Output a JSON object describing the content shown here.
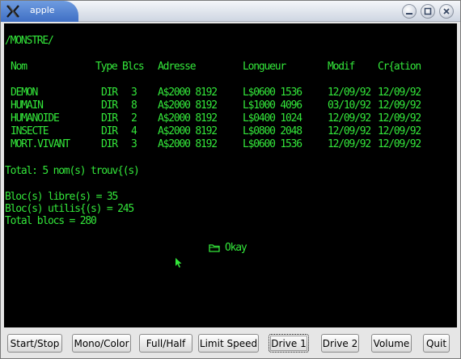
{
  "window": {
    "title": "apple"
  },
  "screen": {
    "path": "/MONSTRE/",
    "headers": [
      "Nom",
      "Type",
      "Blcs",
      "Adresse",
      "Longueur",
      "Modif",
      "Cr{ation"
    ],
    "rows": [
      [
        "DEMON",
        "DIR",
        "3",
        "A$2000 8192",
        "L$0600 1536",
        "12/09/92",
        "12/09/92"
      ],
      [
        "HUMAIN",
        "DIR",
        "8",
        "A$2000 8192",
        "L$1000 4096",
        "03/10/92",
        "12/09/92"
      ],
      [
        "HUMANOIDE",
        "DIR",
        "2",
        "A$2000 8192",
        "L$0400 1024",
        "12/09/92",
        "12/09/92"
      ],
      [
        "INSECTE",
        "DIR",
        "4",
        "A$2000 8192",
        "L$0800 2048",
        "12/09/92",
        "12/09/92"
      ],
      [
        "MORT.VIVANT",
        "DIR",
        "3",
        "A$2000 8192",
        "L$0600 1536",
        "12/09/92",
        "12/09/92"
      ]
    ],
    "total_found": "Total: 5 nom(s) trouv{(s)",
    "free_blocks": "Bloc(s) libre(s) = 35",
    "used_blocks": "Bloc(s) utilis{(s) = 245",
    "total_blocks": "Total blocs = 280",
    "okay_label": "Okay",
    "text_color": "#33e63a"
  },
  "buttons": {
    "start_stop": "Start/Stop",
    "mono_color": "Mono/Color",
    "full_half": "Full/Half",
    "limit_speed": "Limit Speed",
    "drive1": "Drive 1",
    "drive2": "Drive 2",
    "volume": "Volume",
    "quit": "Quit"
  },
  "icons": {
    "app": "x-app-icon",
    "minimize": "minimize-icon",
    "maximize": "maximize-icon",
    "close": "close-icon",
    "folder": "folder-icon",
    "cursor": "mouse-cursor-icon"
  }
}
